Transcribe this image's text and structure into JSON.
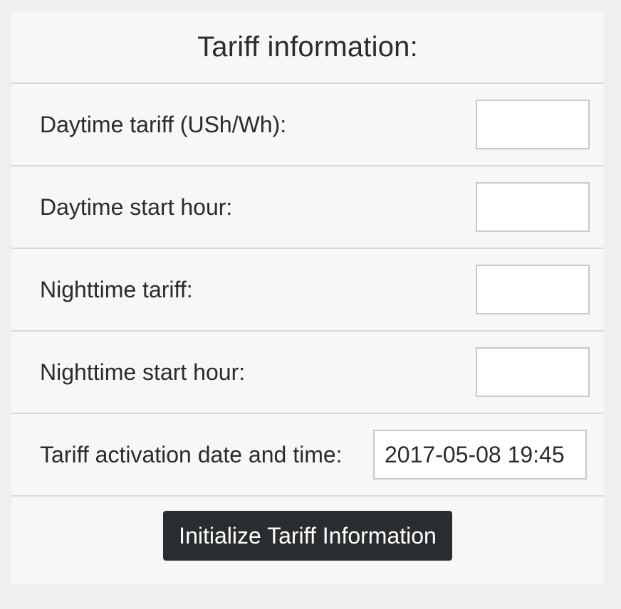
{
  "form": {
    "title": "Tariff information:",
    "fields": [
      {
        "label": "Daytime tariff (USh/Wh):",
        "value": "",
        "placeholder": ""
      },
      {
        "label": "Daytime start hour:",
        "value": "",
        "placeholder": ""
      },
      {
        "label": "Nighttime tariff:",
        "value": "",
        "placeholder": ""
      },
      {
        "label": "Nighttime start hour:",
        "value": "",
        "placeholder": ""
      },
      {
        "label": "Tariff activation date and time:",
        "value": "2017-05-08 19:45",
        "placeholder": ""
      }
    ],
    "submit_label": "Initialize Tariff Information"
  },
  "colors": {
    "page_background": "#efefef",
    "panel_background": "#f7f7f7",
    "divider": "#d8d8d8",
    "input_border": "#c9c9c9",
    "button_background": "#2a2d2f",
    "button_text": "#ffffff",
    "text": "#2b2b2b"
  }
}
